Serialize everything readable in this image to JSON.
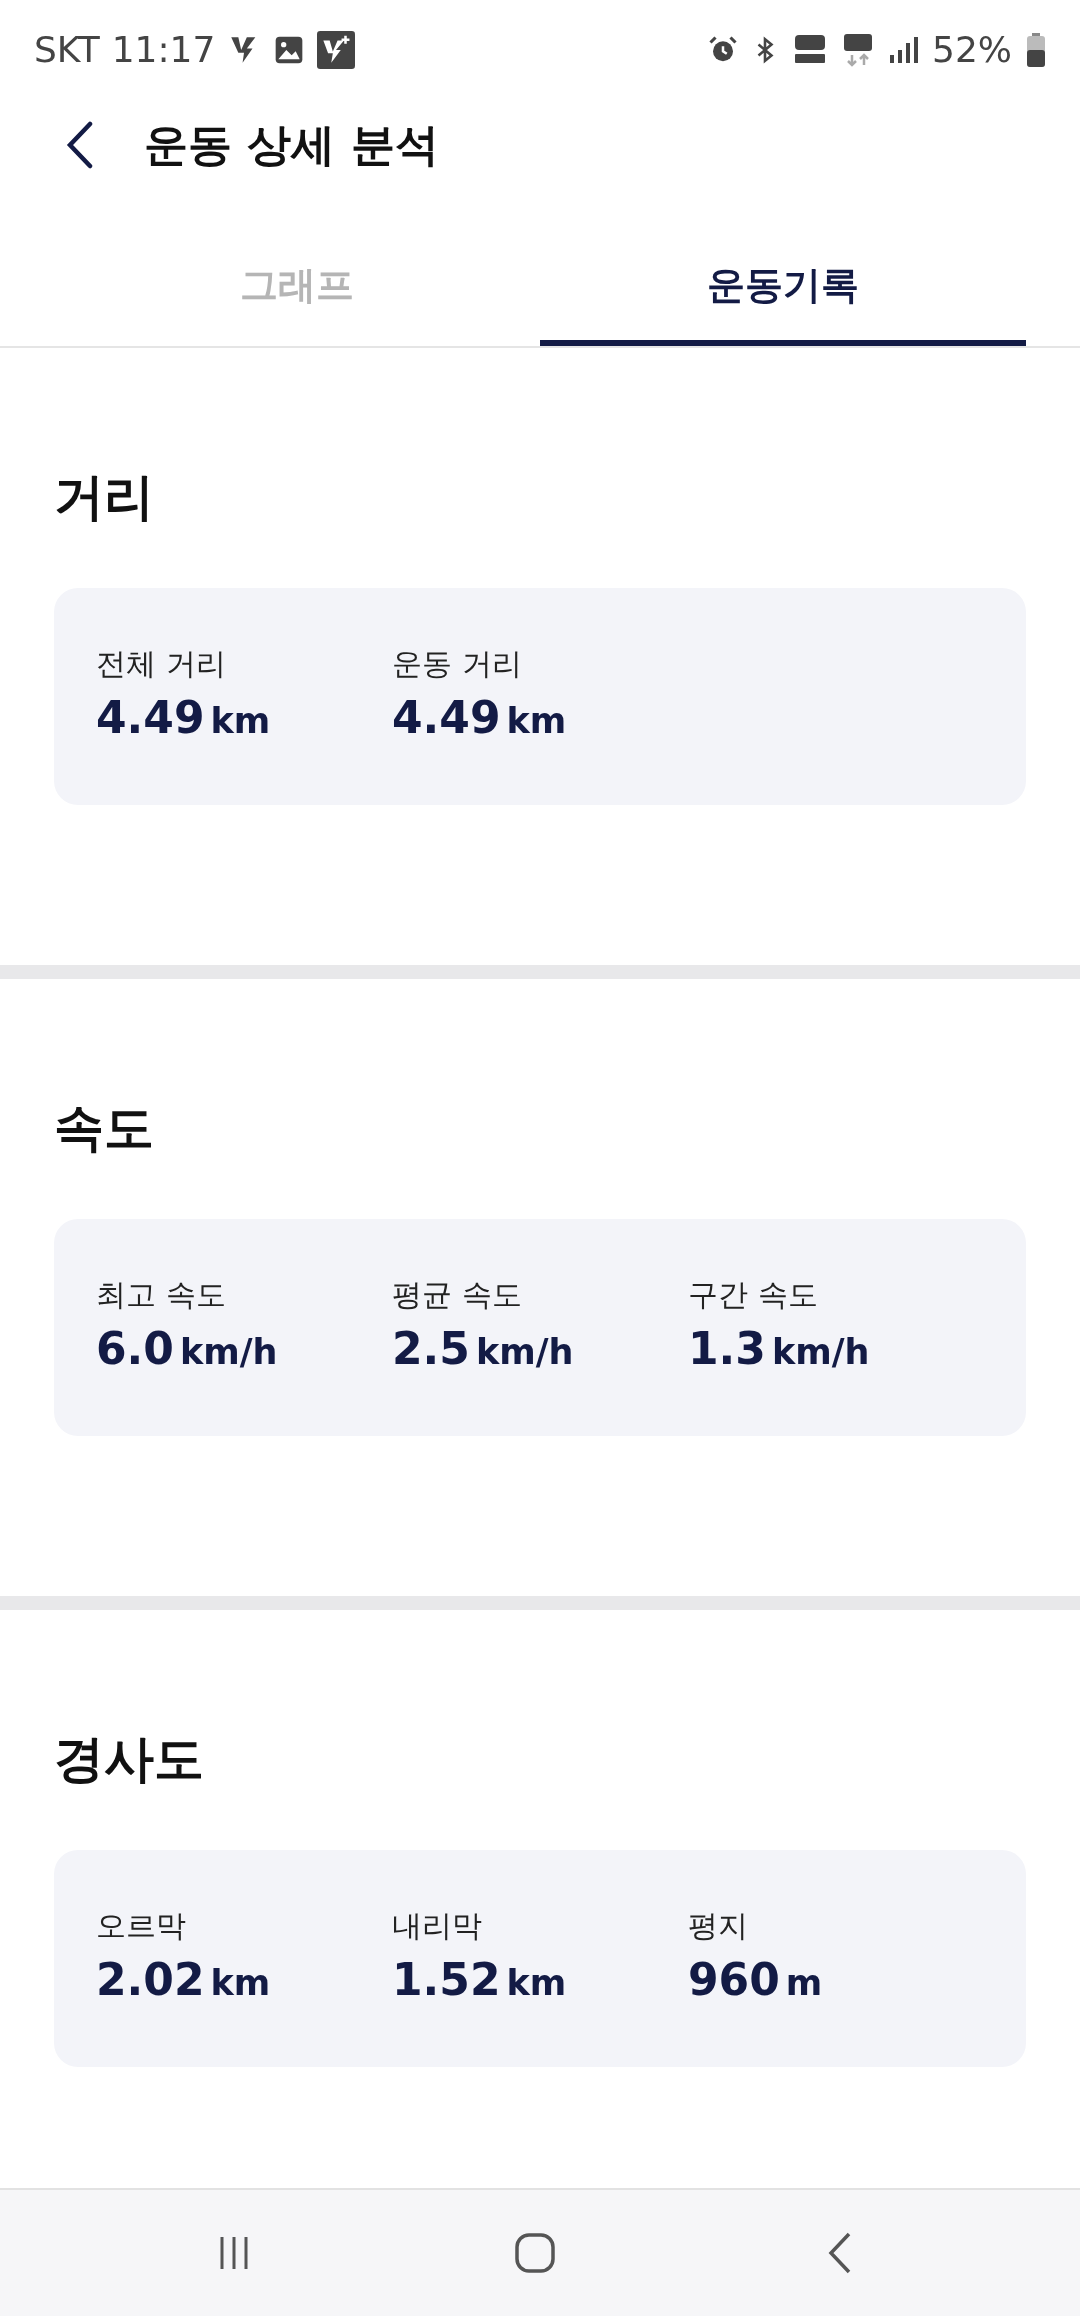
{
  "status_bar": {
    "carrier": "SKT",
    "time": "11:17",
    "battery": "52%"
  },
  "header": {
    "title": "운동 상세 분석"
  },
  "tabs": [
    {
      "label": "그래프",
      "selected": false
    },
    {
      "label": "운동기록",
      "selected": true
    }
  ],
  "sections": [
    {
      "title": "거리",
      "stats": [
        {
          "label": "전체 거리",
          "value": "4.49",
          "unit": "km"
        },
        {
          "label": "운동 거리",
          "value": "4.49",
          "unit": "km"
        }
      ]
    },
    {
      "title": "속도",
      "stats": [
        {
          "label": "최고 속도",
          "value": "6.0",
          "unit": "km/h"
        },
        {
          "label": "평균 속도",
          "value": "2.5",
          "unit": "km/h"
        },
        {
          "label": "구간 속도",
          "value": "1.3",
          "unit": "km/h"
        }
      ]
    },
    {
      "title": "경사도",
      "stats": [
        {
          "label": "오르막",
          "value": "2.02",
          "unit": "km"
        },
        {
          "label": "내리막",
          "value": "1.52",
          "unit": "km"
        },
        {
          "label": "평지",
          "value": "960",
          "unit": "m"
        }
      ]
    }
  ]
}
